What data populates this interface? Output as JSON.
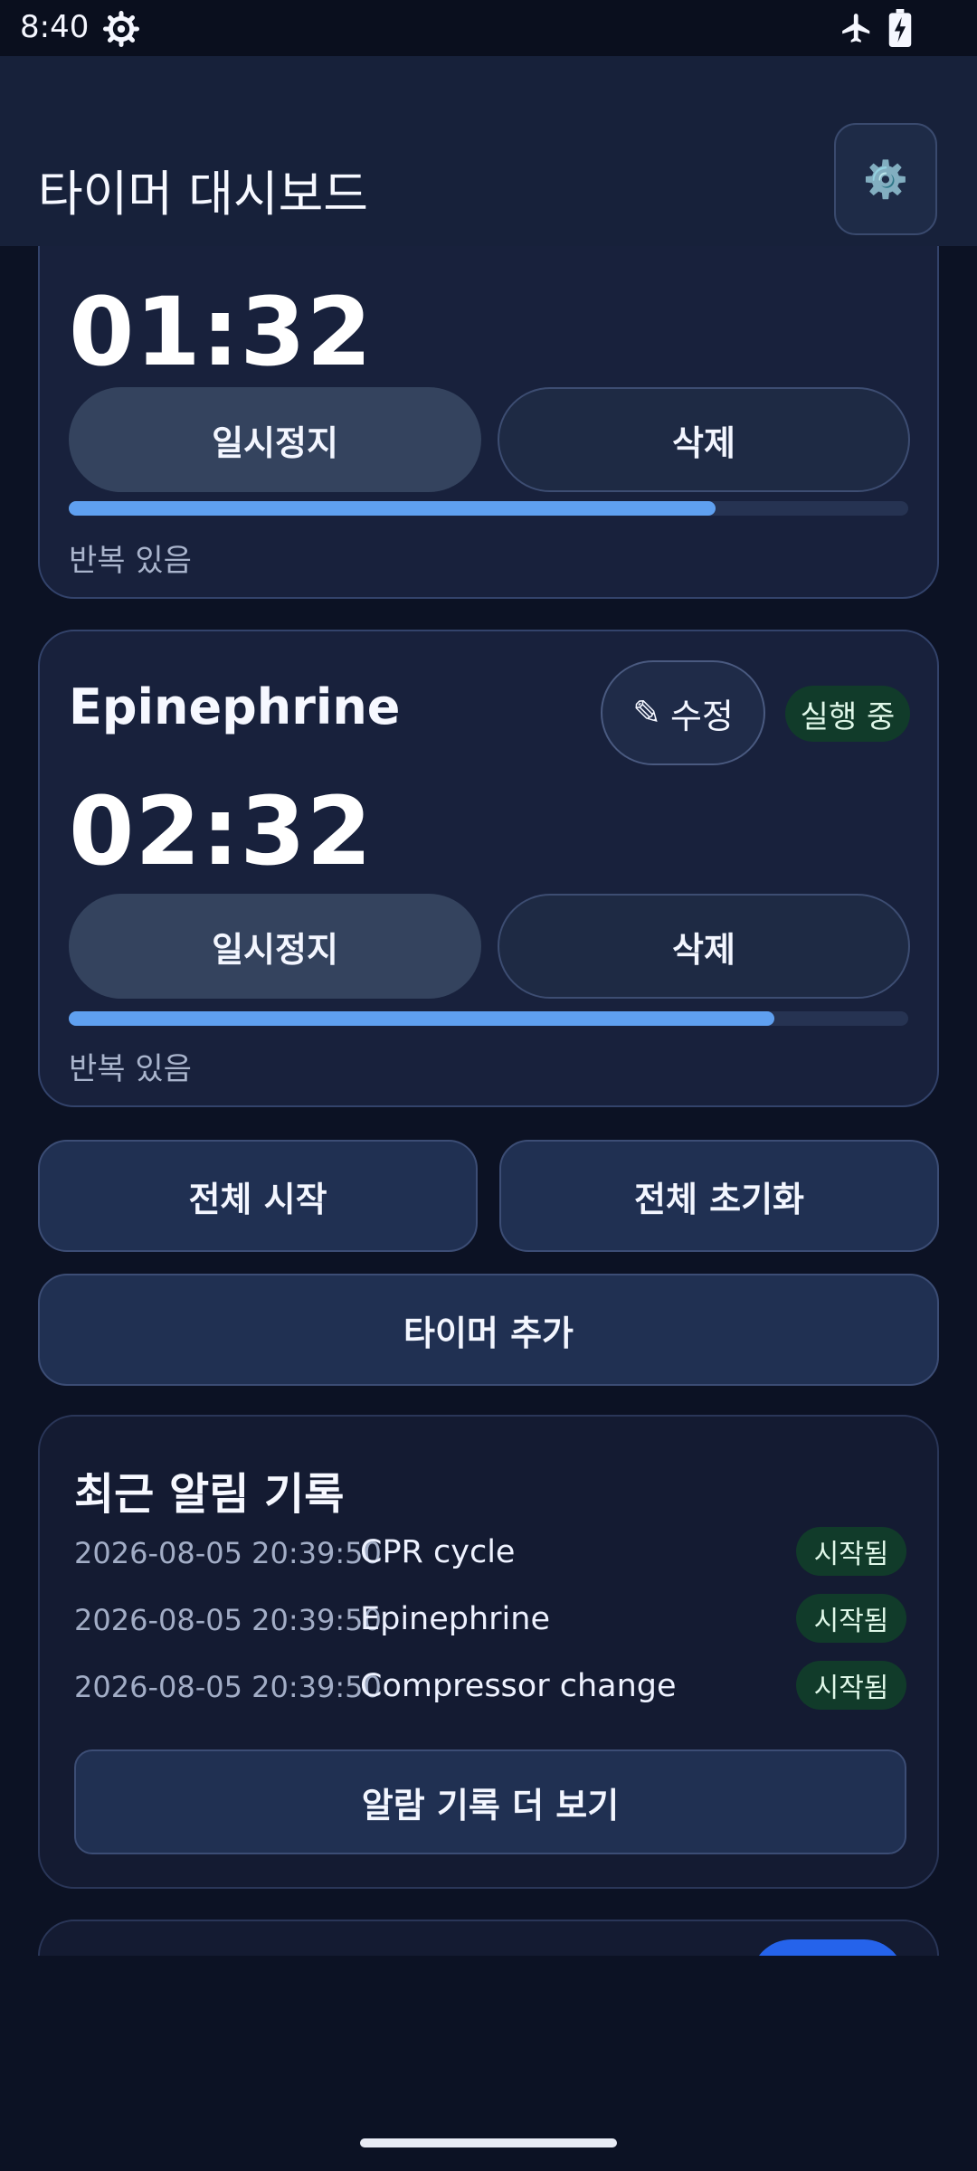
{
  "status_bar": {
    "time": "8:40"
  },
  "header": {
    "title": "타이머 대시보드",
    "settings_icon": "⚙️"
  },
  "timers": [
    {
      "name": "",
      "time": "01:32",
      "progress": 0.77,
      "pause_label": "일시정지",
      "delete_label": "삭제",
      "repeat_text": "반복 있음"
    },
    {
      "name": "Epinephrine",
      "edit_label": "수정",
      "edit_icon": "✎",
      "status": "실행 중",
      "time": "02:32",
      "progress": 0.84,
      "pause_label": "일시정지",
      "delete_label": "삭제",
      "repeat_text": "반복 있음"
    }
  ],
  "actions": {
    "start_all": "전체 시작",
    "reset_all": "전체 초기화",
    "add_timer": "타이머 추가"
  },
  "log": {
    "title": "최근 알림 기록",
    "entries": [
      {
        "time": "2026-08-05 20:39:50",
        "label": "CPR cycle",
        "status": "시작됨"
      },
      {
        "time": "2026-08-05 20:39:50",
        "label": "Epinephrine",
        "status": "시작됨"
      },
      {
        "time": "2026-08-05 20:39:50",
        "label": "Compressor change",
        "status": "시작됨"
      }
    ],
    "more_label": "알람 기록 더 보기"
  },
  "colors": {
    "background": "#0c1224",
    "card": "#18213c",
    "accent_blue": "#5fa0f0",
    "badge_green": "#113b2a",
    "primary_pill": "#2563eb"
  }
}
